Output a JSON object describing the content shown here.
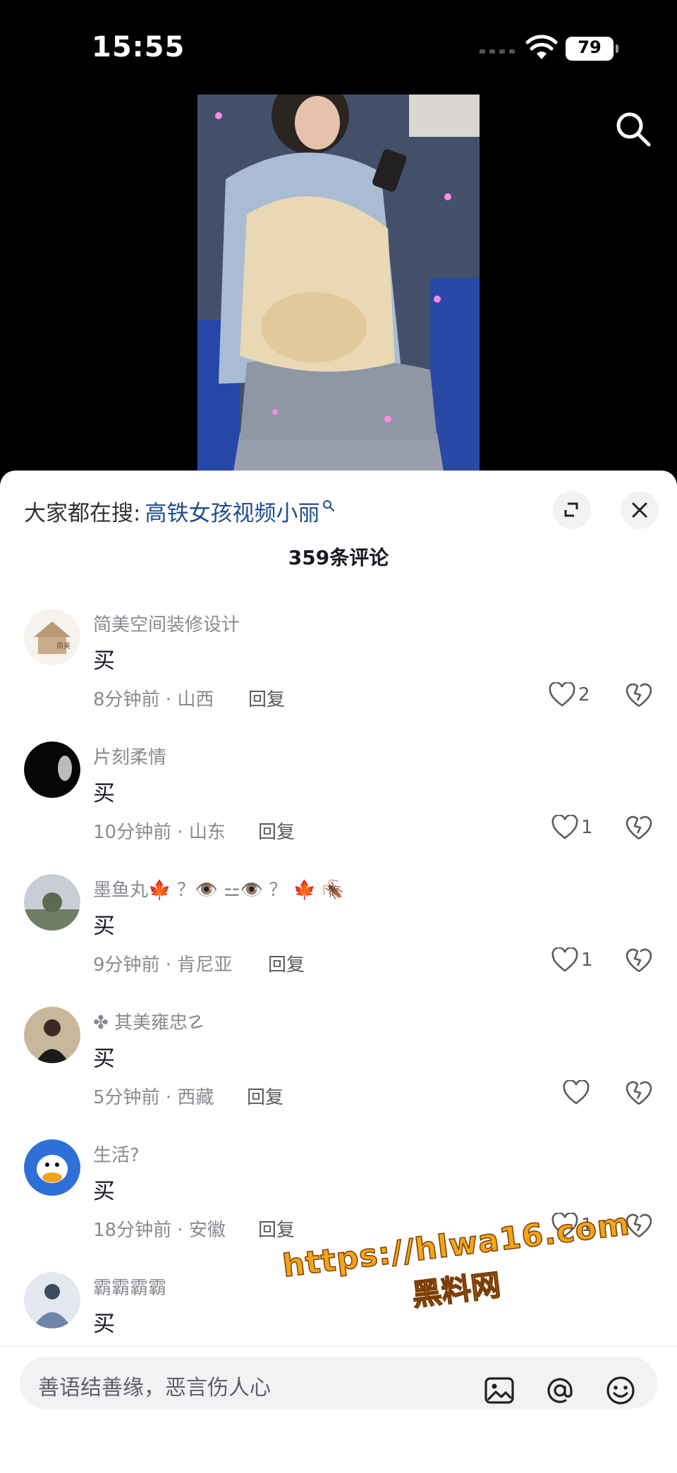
{
  "status_bar": {
    "time": "15:55",
    "battery": "79"
  },
  "search_icon": "search-icon",
  "sheet": {
    "trend_prefix": "大家都在搜:",
    "trend_query": "高铁女孩视频小丽",
    "comment_count": "359条评论"
  },
  "comments": [
    {
      "name": "简美空间装修设计",
      "text": "买",
      "time_location": "8分钟前 · 山西",
      "reply": "回复",
      "likes": "2"
    },
    {
      "name": "片刻柔情",
      "text": "买",
      "time_location": "10分钟前 · 山东",
      "reply": "回复",
      "likes": "1"
    },
    {
      "name": "墨鱼丸🍁 ？👁️ ⚍👁️ ？ 🍁 🪳",
      "text": "买",
      "time_location": "9分钟前 · 肯尼亚",
      "reply": "回复",
      "likes": "1"
    },
    {
      "name": "✤ 其美雍忠☡",
      "text": "买",
      "time_location": "5分钟前 · 西藏",
      "reply": "回复",
      "likes": ""
    },
    {
      "name": "生活?",
      "text": "买",
      "time_location": "18分钟前 · 安徽",
      "reply": "回复",
      "likes": "1"
    },
    {
      "name": "霸霸霸霸",
      "text": "买",
      "time_location": "",
      "reply": "",
      "likes": ""
    }
  ],
  "watermark": {
    "url": "https://hlwa16.com",
    "name": "黑料网"
  },
  "input": {
    "placeholder": "善语结善缘，恶言伤人心"
  },
  "colors": {
    "link": "#1f4e8c",
    "watermark": "#f4a417",
    "muted": "#8a8b91"
  }
}
